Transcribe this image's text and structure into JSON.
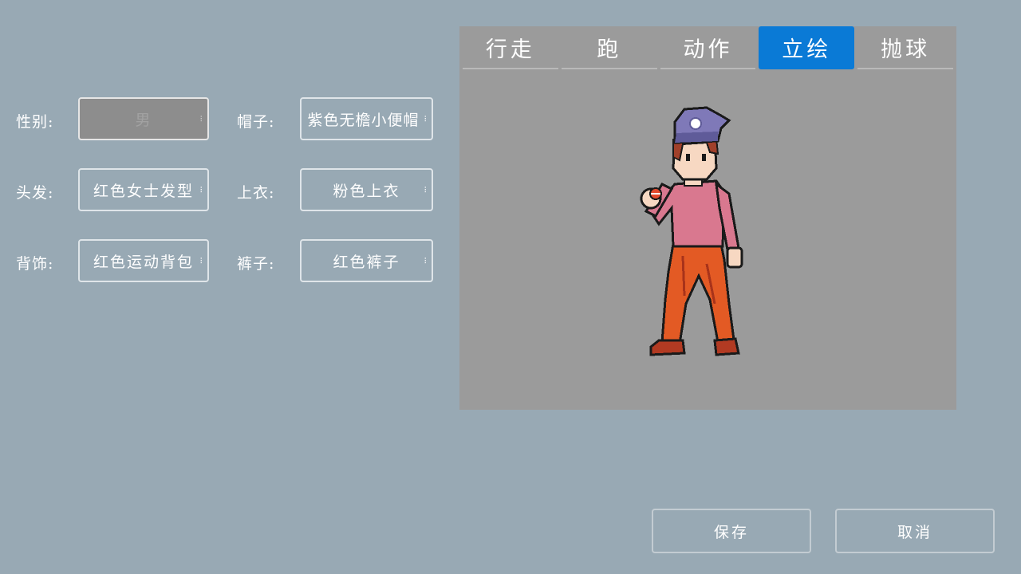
{
  "form": {
    "gender": {
      "label": "性别:",
      "value": "男",
      "disabled": true
    },
    "hat": {
      "label": "帽子:",
      "value": "紫色无檐小便帽"
    },
    "hair": {
      "label": "头发:",
      "value": "红色女士发型"
    },
    "top": {
      "label": "上衣:",
      "value": "粉色上衣"
    },
    "back": {
      "label": "背饰:",
      "value": "红色运动背包"
    },
    "pants": {
      "label": "裤子:",
      "value": "红色裤子"
    }
  },
  "preview": {
    "tabs": [
      {
        "label": "行走"
      },
      {
        "label": "跑"
      },
      {
        "label": "动作"
      },
      {
        "label": "立绘",
        "active": true
      },
      {
        "label": "抛球"
      }
    ]
  },
  "actions": {
    "save_label": "保存",
    "cancel_label": "取消"
  },
  "colors": {
    "background": "#98a9b4",
    "panel": "#9b9b9b",
    "active_tab": "#0a7ad6",
    "hat": "#7f79b8",
    "hair": "#a0402a",
    "shirt": "#d9788f",
    "pants": "#e35a24",
    "shoes": "#b23a22"
  }
}
